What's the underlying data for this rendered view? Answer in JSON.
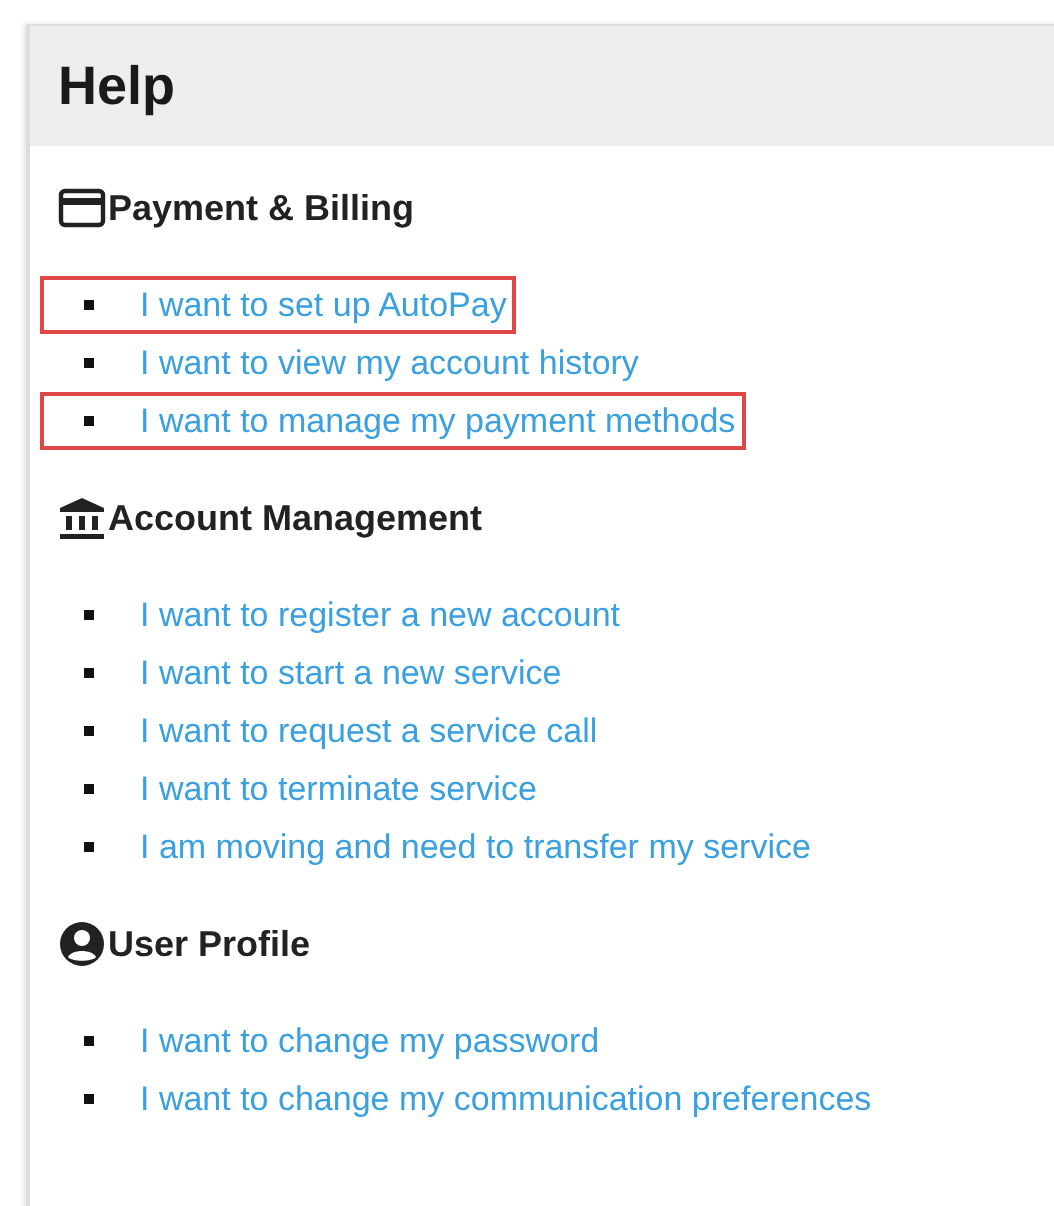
{
  "panel": {
    "title": "Help"
  },
  "sections": [
    {
      "heading": "Payment & Billing",
      "links": [
        {
          "text": "I want to set up AutoPay",
          "highlighted": true
        },
        {
          "text": "I want to view my account history",
          "highlighted": false
        },
        {
          "text": "I want to manage my payment methods",
          "highlighted": true
        }
      ]
    },
    {
      "heading": "Account Management",
      "links": [
        {
          "text": "I want to register a new account",
          "highlighted": false
        },
        {
          "text": "I want to start a new service",
          "highlighted": false
        },
        {
          "text": "I want to request a service call",
          "highlighted": false
        },
        {
          "text": "I want to terminate service",
          "highlighted": false
        },
        {
          "text": "I am moving and need to transfer my service",
          "highlighted": false
        }
      ]
    },
    {
      "heading": "User Profile",
      "links": [
        {
          "text": "I want to change my password",
          "highlighted": false
        },
        {
          "text": "I want to change my communication preferences",
          "highlighted": false
        }
      ]
    }
  ]
}
